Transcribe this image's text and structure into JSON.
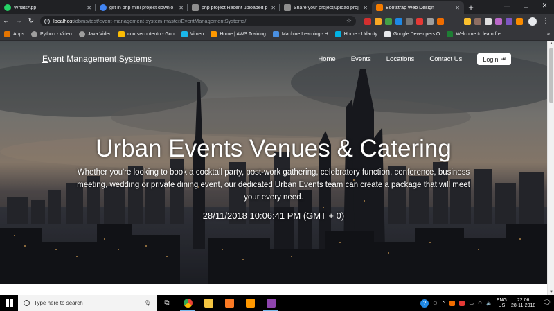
{
  "browser": {
    "tabs": [
      {
        "label": "WhatsApp",
        "color": "#25d366",
        "active": false
      },
      {
        "label": "gst in php mini project downlo",
        "color": "#4285f4",
        "active": false
      },
      {
        "label": "php project.Recent uploaded p",
        "color": "#8e8e8e",
        "active": false
      },
      {
        "label": "Share your project|upload proj",
        "color": "#8e8e8e",
        "active": false
      },
      {
        "label": "Bootstrap Web Design",
        "color": "#f57c00",
        "active": true
      }
    ],
    "new_tab": "+",
    "window_controls": {
      "minimize": "—",
      "maximize": "❐",
      "close": "✕"
    },
    "url_host": "localhost",
    "url_path": "/dbms/test/event-management-system-master/EventManagementSystems/",
    "bookmarks": [
      {
        "label": "Apps",
        "color": "#e37400"
      },
      {
        "label": "Python - Video",
        "color": "#9e9e9e"
      },
      {
        "label": "Java Video",
        "color": "#9e9e9e"
      },
      {
        "label": "coursecontentn - Goo",
        "color": "#fbbc04"
      },
      {
        "label": "Vimeo",
        "color": "#1ab7ea"
      },
      {
        "label": "Home | AWS Training",
        "color": "#ff9900"
      },
      {
        "label": "Machine Learning - H",
        "color": "#4a90e2"
      },
      {
        "label": "Home - Udacity",
        "color": "#02b3e4"
      },
      {
        "label": "Google Developers O",
        "color": "#e8eaed"
      },
      {
        "label": "Welcome to learn.fre",
        "color": "#1e7e34"
      }
    ],
    "bookmarks_more": "»"
  },
  "site": {
    "brand": "Event Management Systems",
    "nav": [
      "Home",
      "Events",
      "Locations",
      "Contact Us"
    ],
    "login_label": "Login",
    "hero_title": "Urban Events Venues & Catering",
    "hero_subtitle": "Whether you're looking to book a cocktail party, post-work gathering, celebratory function, conference, business meeting, wedding or private dining event, our dedicated Urban Events team can create a package that will meet your every need.",
    "hero_time": "28/11/2018 10:06:41 PM (GMT + 0)"
  },
  "taskbar": {
    "search_placeholder": "Type here to search",
    "lang_top": "ENG",
    "lang_bottom": "US",
    "time": "22:06",
    "date": "28-11-2018"
  }
}
